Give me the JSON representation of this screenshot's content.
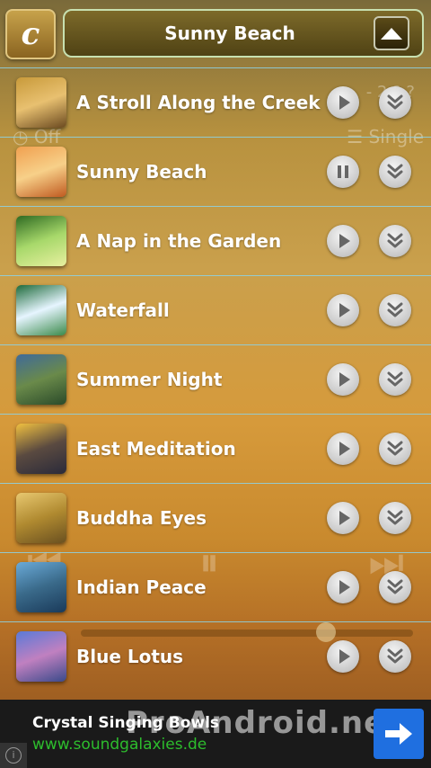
{
  "header": {
    "logo_letter": "c",
    "now_playing_title": "Sunny Beach"
  },
  "background_controls": {
    "repeat_label": "Off",
    "mode_label": "Single",
    "time_fragment": "- 2 ? ?"
  },
  "tracks": [
    {
      "title": "A Stroll Along the Creek",
      "state": "play",
      "colors": [
        "#c89a3a",
        "#e8c070",
        "#6b4a20"
      ]
    },
    {
      "title": "Sunny Beach",
      "state": "pause",
      "colors": [
        "#f0a050",
        "#f7d089",
        "#c05a20"
      ]
    },
    {
      "title": "A Nap in the Garden",
      "state": "play",
      "colors": [
        "#2e6a22",
        "#a7d86a",
        "#e8f0a0"
      ]
    },
    {
      "title": "Waterfall",
      "state": "play",
      "colors": [
        "#1d6a3a",
        "#e6f5ff",
        "#3a8a4a"
      ]
    },
    {
      "title": "Summer Night",
      "state": "play",
      "colors": [
        "#3f6a9a",
        "#6a8a4a",
        "#2a4a2a"
      ]
    },
    {
      "title": "East Meditation",
      "state": "play",
      "colors": [
        "#f0c040",
        "#5a4a40",
        "#2a2a3a"
      ]
    },
    {
      "title": "Buddha Eyes",
      "state": "play",
      "colors": [
        "#e8c870",
        "#b08a30",
        "#6a5020"
      ]
    },
    {
      "title": "Indian Peace",
      "state": "play",
      "colors": [
        "#6aaad8",
        "#3a6a8a",
        "#1a3a5a"
      ]
    },
    {
      "title": "Blue Lotus",
      "state": "play",
      "colors": [
        "#5a7ad8",
        "#c080c0",
        "#3a4a8a"
      ]
    }
  ],
  "ad": {
    "title": "Crystal Singing Bowls",
    "url": "www.soundgalaxies.de",
    "watermark": "ProAndroid.net"
  }
}
